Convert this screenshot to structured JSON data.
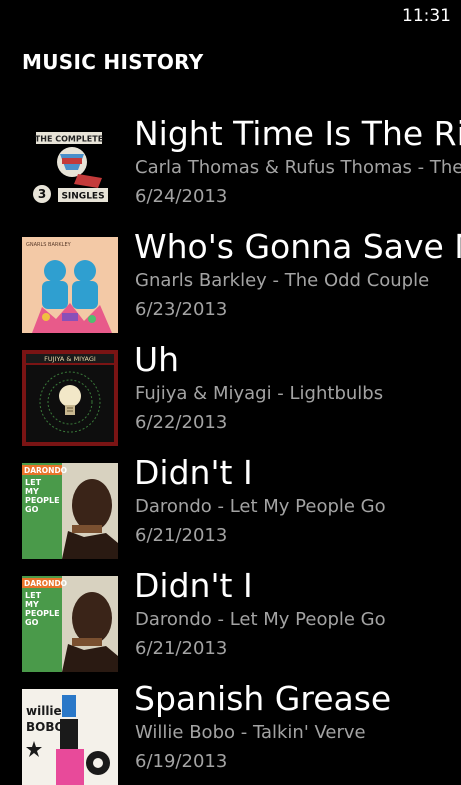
{
  "status_bar": {
    "time": "11:31"
  },
  "page": {
    "title": "MUSIC HISTORY"
  },
  "items": [
    {
      "title": "Night Time Is The Right Time",
      "subtitle": "Carla Thomas & Rufus Thomas - The Complete Stax/Volt Singles",
      "date": "6/24/2013",
      "art": "complete-singles-album-art"
    },
    {
      "title": "Who's Gonna Save My Soul",
      "subtitle": "Gnarls Barkley - The Odd Couple",
      "date": "6/23/2013",
      "art": "odd-couple-album-art"
    },
    {
      "title": "Uh",
      "subtitle": "Fujiya & Miyagi - Lightbulbs",
      "date": "6/22/2013",
      "art": "lightbulbs-album-art"
    },
    {
      "title": "Didn't I",
      "subtitle": "Darondo - Let My People Go",
      "date": "6/21/2013",
      "art": "let-my-people-go-album-art"
    },
    {
      "title": "Didn't I",
      "subtitle": "Darondo - Let My People Go",
      "date": "6/21/2013",
      "art": "let-my-people-go-album-art"
    },
    {
      "title": "Spanish Grease",
      "subtitle": "Willie Bobo - Talkin' Verve",
      "date": "6/19/2013",
      "art": "talkin-verve-album-art"
    }
  ],
  "art_text": {
    "complete": "THE COMPLETE",
    "singles": "SINGLES",
    "num3": "3",
    "gnarls": "GNARLS BARKLEY",
    "fujiya": "FUJIYA & MIYAGI",
    "darondo": "DARONDO",
    "let": "LET",
    "my": "MY",
    "people": "PEOPLE",
    "go": "GO",
    "willie": "willie",
    "bobo": "BOBO"
  }
}
